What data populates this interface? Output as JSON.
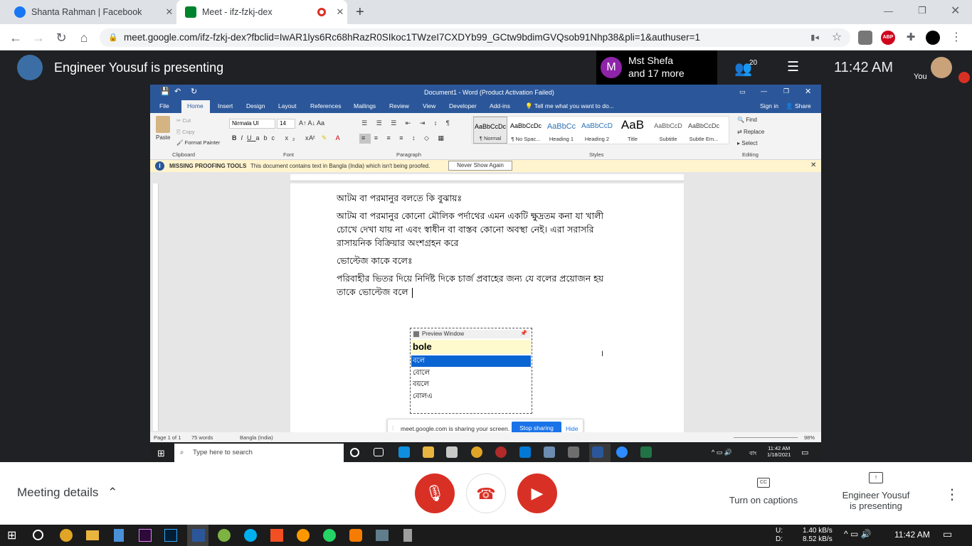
{
  "tabs": [
    {
      "title": "Shanta Rahman | Facebook"
    },
    {
      "title": "Meet - ifz-fzkj-dex"
    }
  ],
  "address": {
    "url": "meet.google.com/ifz-fzkj-dex?fbclid=IwAR1lys6Rc68hRazR0SIkoc1TWzeI7CXDYb99_GCtw9bdimGVQsob91Nhp38&pli=1&authuser=1"
  },
  "extensions": {
    "abp": "ABP"
  },
  "meet": {
    "presenter_banner": "Engineer Yousuf is presenting",
    "participants_avatar": "M",
    "participants_name": "Mst Shefa",
    "participants_more": "and 17 more",
    "people_count": "20",
    "time": "11:42 AM",
    "you_label": "You",
    "meeting_details": "Meeting details",
    "captions": "Turn on captions",
    "captions_icon": "CC",
    "presenting_line1": "Engineer Yousuf",
    "presenting_line2": "is presenting"
  },
  "word": {
    "title": "Document1 - Word (Product Activation Failed)",
    "tabs": [
      "File",
      "Home",
      "Insert",
      "Design",
      "Layout",
      "References",
      "Mailings",
      "Review",
      "View",
      "Developer",
      "Add-ins"
    ],
    "tell_me": "Tell me what you want to do...",
    "sign_in": "Sign in",
    "share": "Share",
    "clipboard": {
      "paste": "Paste",
      "cut": "Cut",
      "copy": "Copy",
      "format_painter": "Format Painter",
      "label": "Clipboard"
    },
    "font": {
      "name": "Nirmala UI",
      "size": "14",
      "label": "Font"
    },
    "paragraph_label": "Paragraph",
    "styles": [
      {
        "sample": "AaBbCcDc",
        "name": "¶ Normal"
      },
      {
        "sample": "AaBbCcDc",
        "name": "¶ No Spac..."
      },
      {
        "sample": "AaBbCc",
        "name": "Heading 1"
      },
      {
        "sample": "AaBbCcD",
        "name": "Heading 2"
      },
      {
        "sample": "AaB",
        "name": "Title"
      },
      {
        "sample": "AaBbCcD",
        "name": "Subtitle"
      },
      {
        "sample": "AaBbCcDc",
        "name": "Subtle Em..."
      }
    ],
    "styles_label": "Styles",
    "editing": {
      "find": "Find",
      "replace": "Replace",
      "select": "Select",
      "label": "Editing"
    },
    "info": {
      "title": "MISSING PROOFING TOOLS",
      "text": "This document contains text in Bangla (India) which isn't being proofed.",
      "button": "Never Show Again"
    },
    "doc_lines": [
      "আটম বা পরমানুর বলতে কি বুঝায়ঃ",
      "আটম বা পরমানুর কোনো মৌলিক পর্দাথের এমন একটি ক্ষুদ্রতম কনা যা খালী",
      "চোখে দেখা যায় না এবং স্বাধীন বা বাস্তব কোনো অবস্থা নেই। এরা সরাসরি",
      "রাসায়নিক বিক্রিয়ার অংশগ্রহন করে",
      "ভোল্টেজ কাকে বলেঃ",
      "পরিবাহীর ভিতর দিয়ে নির্দিষ্ট দিকে চার্জ প্রবাহের জন্য যে বলের প্রয়োজন হয়",
      "তাকে ভোল্টেজ বলে"
    ],
    "preview": {
      "title": "Preview Window",
      "typed": "bole",
      "options": [
        "বলে",
        "বোলে",
        "বয়লে",
        "বোলএ"
      ]
    },
    "share_notice": {
      "text": "meet.google.com is sharing your screen.",
      "stop": "Stop sharing",
      "hide": "Hide"
    },
    "status": {
      "page": "Page 1 of 1",
      "words": "75 words",
      "lang": "Bangla (India)",
      "zoom": "98%"
    },
    "taskbar": {
      "search": "Type here to search",
      "time": "11:42 AM",
      "date": "1/18/2021",
      "lang": "বাং"
    }
  },
  "os": {
    "net_up_label": "U:",
    "net_down_label": "D:",
    "net_up": "1.40 kB/s",
    "net_down": "8.52 kB/s",
    "time": "11:42 AM"
  }
}
